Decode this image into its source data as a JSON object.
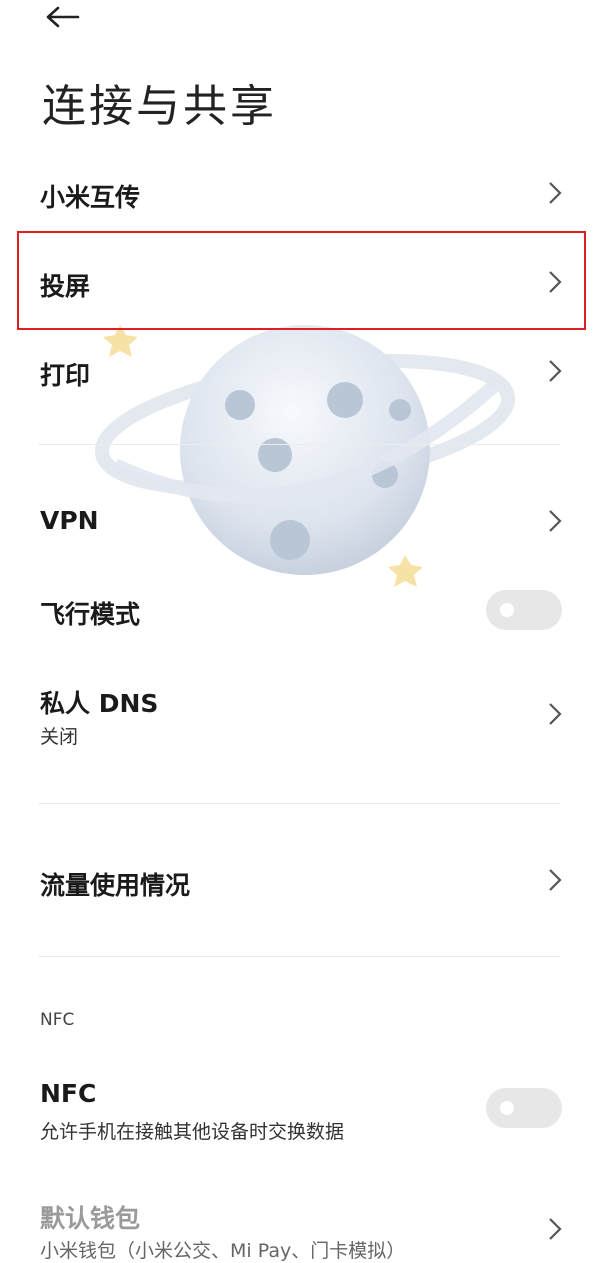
{
  "header": {
    "back_icon": "arrow-left-icon",
    "title": "连接与共享"
  },
  "items": {
    "mi_share": {
      "label": "小米互传",
      "icon": "chevron-right-icon"
    },
    "cast": {
      "label": "投屏",
      "icon": "chevron-right-icon",
      "highlighted": true,
      "highlight_color": "#e02020"
    },
    "print": {
      "label": "打印",
      "icon": "chevron-right-icon"
    },
    "vpn": {
      "label": "VPN",
      "icon": "chevron-right-icon"
    },
    "airplane": {
      "label": "飞行模式",
      "toggle_on": false
    },
    "private_dns": {
      "label": "私人 DNS",
      "sub": "关闭",
      "icon": "chevron-right-icon"
    },
    "data_usage": {
      "label": "流量使用情况",
      "icon": "chevron-right-icon"
    },
    "nfc_section": {
      "label": "NFC"
    },
    "nfc": {
      "label": "NFC",
      "sub": "允许手机在接触其他设备时交换数据",
      "toggle_on": false
    },
    "default_wallet": {
      "label": "默认钱包",
      "sub": "小米钱包（小米公交、Mi Pay、门卡模拟）",
      "icon": "chevron-right-icon"
    }
  },
  "decoration": {
    "name": "planet-illustration"
  }
}
